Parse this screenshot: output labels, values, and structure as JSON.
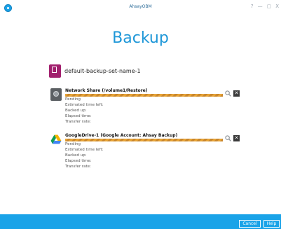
{
  "window": {
    "app_title": "AhsayOBM",
    "controls": [
      "?",
      "—",
      "▢",
      "X"
    ]
  },
  "page": {
    "heading": "Backup"
  },
  "backup_set": {
    "name": "default-backup-set-name-1"
  },
  "destinations": [
    {
      "title": "Network Share (/volume1/Restore)",
      "status": "Pending",
      "estimated_time_left_label": "Estimated time left:",
      "backed_up_label": "Backed up:",
      "elapsed_time_label": "Elapsed time:",
      "transfer_rate_label": "Transfer rate:",
      "icon": "network-share-icon"
    },
    {
      "title": "GoogleDrive-1 (Google Account: Ahsay Backup)",
      "status": "Pending",
      "estimated_time_left_label": "Estimated time left:",
      "backed_up_label": "Backed up:",
      "elapsed_time_label": "Elapsed time:",
      "transfer_rate_label": "Transfer rate:",
      "icon": "google-drive-icon"
    }
  ],
  "footer": {
    "cancel_label": "Cancel",
    "help_label": "Help"
  },
  "colors": {
    "accent": "#1aa3e8",
    "heading": "#1e97d8",
    "progress": "#e7a437",
    "doc_icon": "#a2206e"
  }
}
